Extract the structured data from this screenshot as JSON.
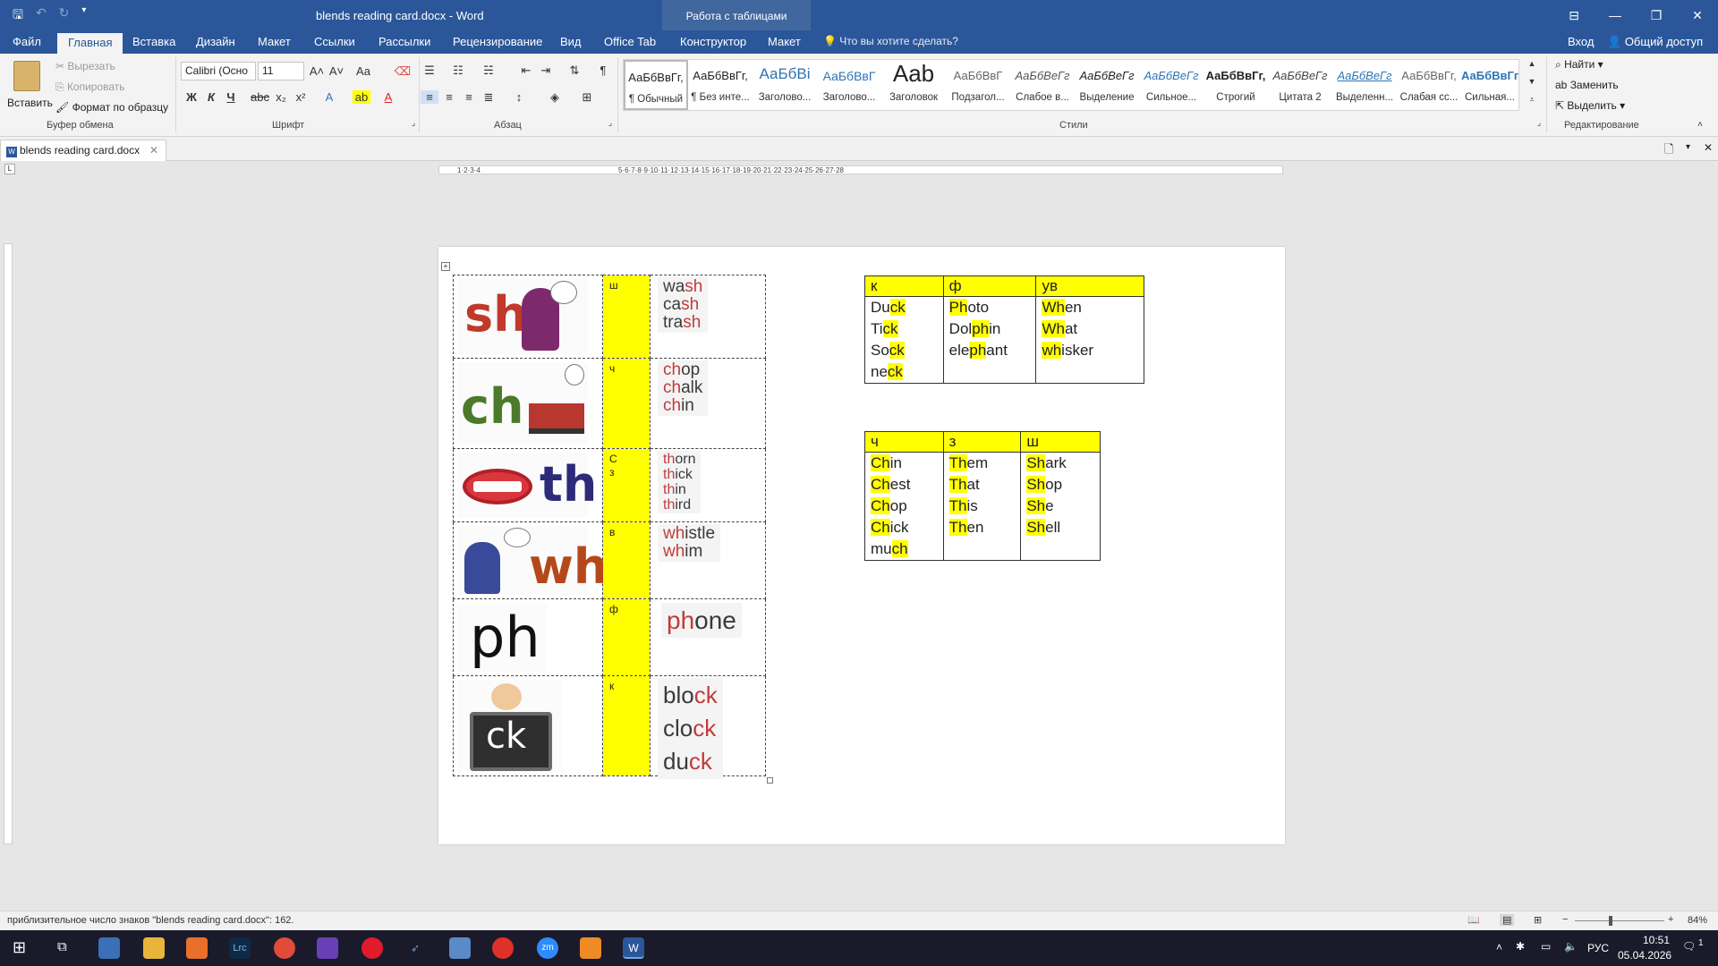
{
  "window": {
    "title": "blends reading card.docx - Word",
    "context_tab": "Работа с таблицами",
    "controls": [
      "⊟",
      "—",
      "❐",
      "✕"
    ]
  },
  "tabs": [
    "Файл",
    "Главная",
    "Вставка",
    "Дизайн",
    "Макет",
    "Ссылки",
    "Рассылки",
    "Рецензирование",
    "Вид",
    "Office Tab",
    "Конструктор",
    "Макет"
  ],
  "tell_me": "Что вы хотите сделать?",
  "sign_in": "Вход",
  "share": "Общий доступ",
  "clipboard": {
    "paste": "Вставить",
    "cut": "Вырезать",
    "copy": "Копировать",
    "format_painter": "Формат по образцу",
    "label": "Буфер обмена"
  },
  "font": {
    "name": "Calibri (Осно",
    "size": "11",
    "label": "Шрифт",
    "bold": "Ж",
    "italic": "К",
    "underline": "Ч"
  },
  "paragraph": {
    "label": "Абзац"
  },
  "styles": {
    "label": "Стили",
    "items": [
      {
        "sample": "АаБбВвГг,",
        "name": "¶ Обычный"
      },
      {
        "sample": "АаБбВвГг,",
        "name": "¶ Без инте..."
      },
      {
        "sample": "АаБбВі",
        "name": "Заголово..."
      },
      {
        "sample": "АаБбВвГ",
        "name": "Заголово..."
      },
      {
        "sample": "Aab",
        "name": "Заголовок"
      },
      {
        "sample": "АаБбВвГ",
        "name": "Подзагол..."
      },
      {
        "sample": "АаБбВеГг",
        "name": "Слабое в..."
      },
      {
        "sample": "АаБбВеГг",
        "name": "Выделение"
      },
      {
        "sample": "АаБбВеГг",
        "name": "Сильное..."
      },
      {
        "sample": "АаБбВвГг,",
        "name": "Строгий"
      },
      {
        "sample": "АаБбВеГг",
        "name": "Цитата 2"
      },
      {
        "sample": "АаБбВеГг",
        "name": "Выделенн..."
      },
      {
        "sample": "АаБбВвГг,",
        "name": "Слабая сс..."
      },
      {
        "sample": "АаБбВвГг,",
        "name": "Сильная..."
      }
    ]
  },
  "editing": {
    "find": "Найти",
    "replace": "Заменить",
    "select": "Выделить",
    "label": "Редактирование"
  },
  "doc_tab": "blends reading card.docx",
  "cards": [
    {
      "blend": "sh",
      "sound": "ш",
      "words": [
        [
          "wa",
          "sh"
        ],
        [
          "ca",
          "sh"
        ],
        [
          "tra",
          "sh"
        ]
      ]
    },
    {
      "blend": "ch",
      "sound": "ч",
      "words": [
        [
          "ch",
          "op"
        ],
        [
          "ch",
          "alk"
        ],
        [
          "ch",
          "in"
        ]
      ]
    },
    {
      "blend": "th",
      "sound": "С\nз",
      "words": [
        [
          "th",
          "orn"
        ],
        [
          "th",
          "ick"
        ],
        [
          "th",
          "in"
        ],
        [
          "th",
          "ird"
        ]
      ]
    },
    {
      "blend": "wh",
      "sound": "в",
      "words": [
        [
          "wh",
          "istle"
        ],
        [
          "wh",
          "im"
        ]
      ]
    },
    {
      "blend": "ph",
      "sound": "ф",
      "words": [
        [
          "ph",
          "one"
        ]
      ]
    },
    {
      "blend": "ck",
      "sound": "к",
      "words": [
        [
          "blo",
          "ck"
        ],
        [
          "clo",
          "ck"
        ],
        [
          "du",
          "ck"
        ]
      ]
    }
  ],
  "table1": {
    "headers": [
      "к",
      "ф",
      "ув"
    ],
    "rows": [
      [
        [
          "Du",
          "ck",
          ""
        ],
        [
          "",
          "Ph",
          "oto"
        ],
        [
          "",
          "Wh",
          "en"
        ]
      ],
      [
        [
          "Ti",
          "ck",
          ""
        ],
        [
          "Dol",
          "ph",
          "in"
        ],
        [
          "",
          "Wh",
          "at"
        ]
      ],
      [
        [
          "So",
          "ck",
          ""
        ],
        [
          "ele",
          "ph",
          "ant"
        ],
        [
          "",
          "wh",
          "isker"
        ]
      ],
      [
        [
          "ne",
          "ck",
          ""
        ],
        [
          "",
          "",
          ""
        ],
        [
          "",
          "",
          ""
        ]
      ]
    ]
  },
  "table2": {
    "headers": [
      "ч",
      "з",
      "ш"
    ],
    "rows": [
      [
        [
          "",
          "Ch",
          "in"
        ],
        [
          "",
          "Th",
          "em"
        ],
        [
          "",
          "Sh",
          "ark"
        ]
      ],
      [
        [
          "",
          "Ch",
          "est"
        ],
        [
          "",
          "Th",
          "at"
        ],
        [
          "",
          "Sh",
          "op"
        ]
      ],
      [
        [
          "",
          "Ch",
          "op"
        ],
        [
          "",
          "Th",
          "is"
        ],
        [
          "",
          "Sh",
          "e"
        ]
      ],
      [
        [
          "",
          "Ch",
          "ick"
        ],
        [
          "",
          "Th",
          "en"
        ],
        [
          "",
          "Sh",
          "ell"
        ]
      ],
      [
        [
          "mu",
          "ch",
          ""
        ],
        [
          "",
          "",
          ""
        ],
        [
          "",
          "",
          ""
        ]
      ]
    ]
  },
  "status": {
    "text": "приблизительное число знаков \"blends reading card.docx\": 162.",
    "zoom": "84%"
  },
  "taskbar": {
    "lang": "РУС",
    "time": "10:51",
    "date": "05.04.2026",
    "notif": "1"
  },
  "colors": {
    "accent": "#2b579a",
    "highlight": "#ffff00",
    "blend_red": "#c0392b"
  }
}
